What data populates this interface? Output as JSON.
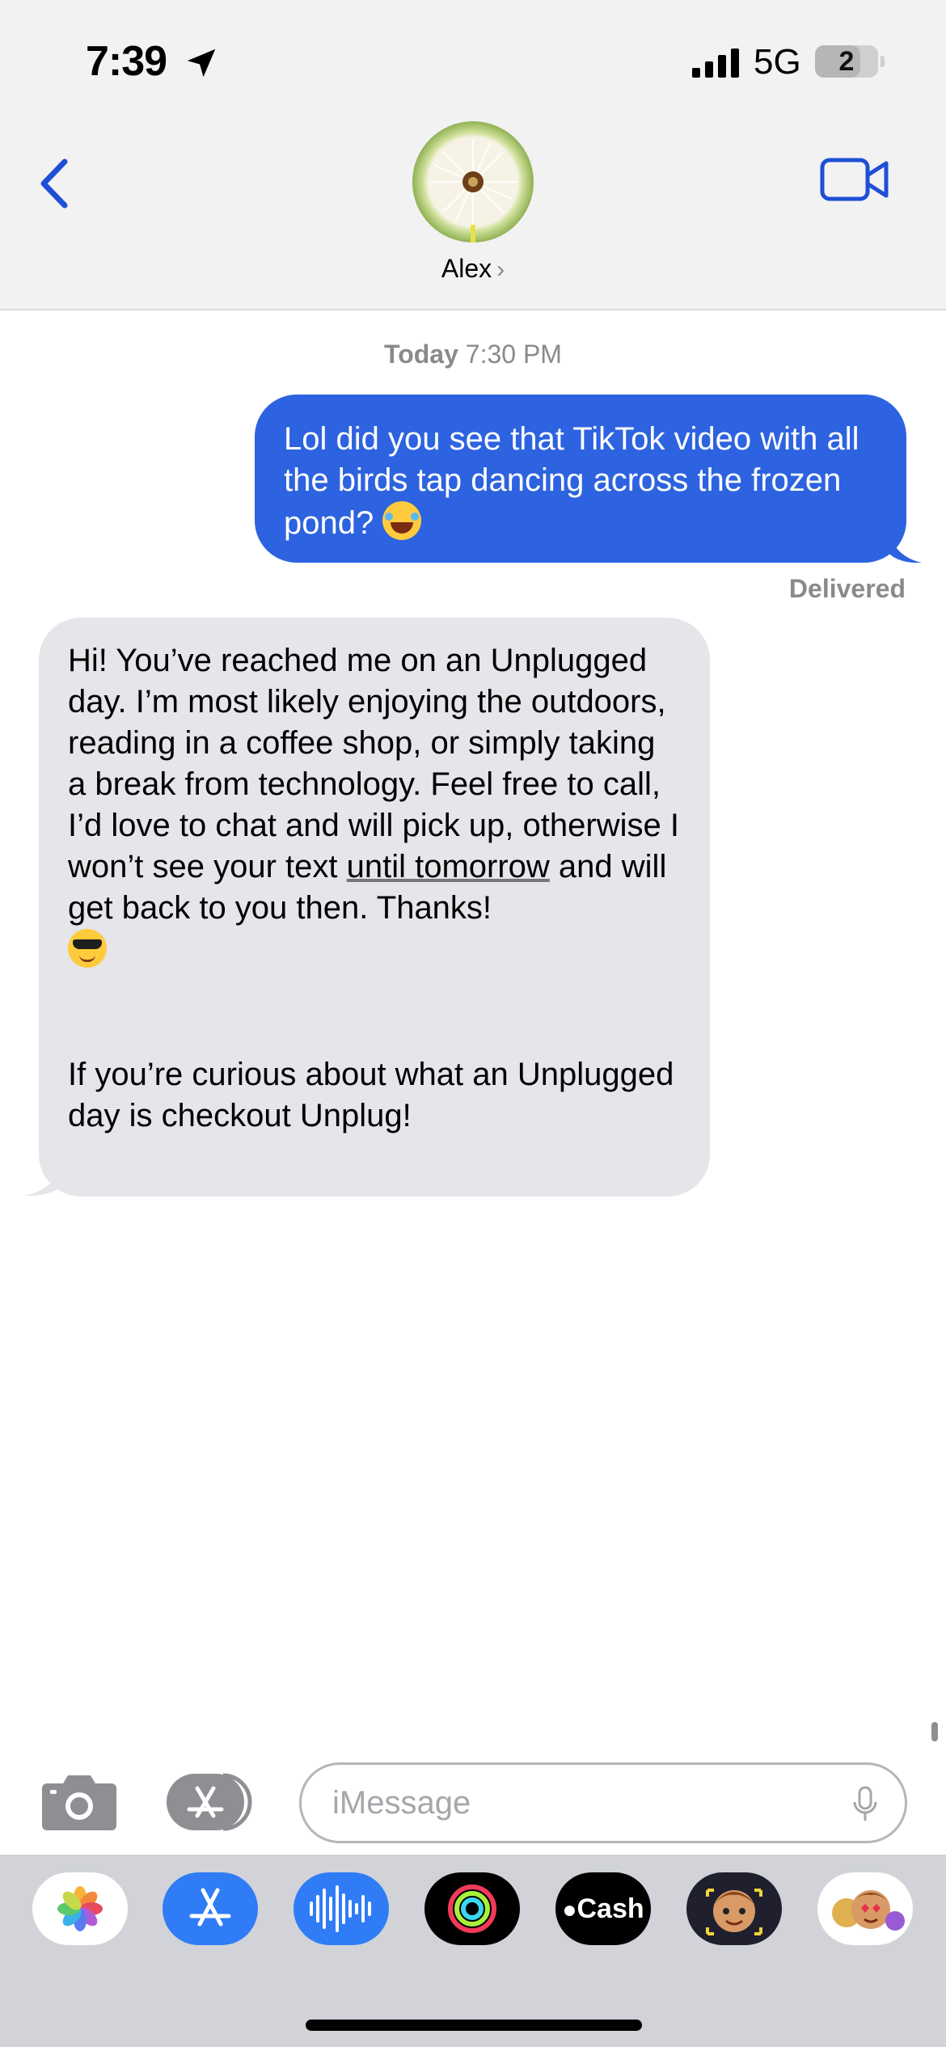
{
  "status_bar": {
    "time": "7:39",
    "network": "5G",
    "battery_level": "2",
    "location_icon": "location-arrow-icon",
    "signal_icon": "cellular-signal-icon"
  },
  "header": {
    "back_icon": "chevron-left-icon",
    "contact_name": "Alex",
    "contact_chevron": "›",
    "video_icon": "video-camera-icon",
    "avatar": "dandelion-photo"
  },
  "conversation": {
    "timestamp_day": "Today",
    "timestamp_time": "7:30 PM",
    "outgoing": {
      "text": "Lol did you see that TikTok video with all the birds tap dancing across the frozen pond?",
      "emoji": "laughing-crying-emoji",
      "status": "Delivered"
    },
    "incoming": {
      "text_before_link": "Hi! You’ve reached me on an Unplugged day. I’m most likely enjoying the outdoors, reading in a coffee shop, or simply taking a break from technology. Feel free to call, I’d love to chat and will pick up, otherwise I won’t see your text ",
      "link_text": "until tomorrow",
      "text_after_link": " and will get back to you then. Thanks!",
      "emoji": "sunglasses-emoji",
      "second_paragraph": "If you’re curious about what an Unplugged day is checkout Unplug!"
    }
  },
  "input_bar": {
    "placeholder": "iMessage",
    "camera_icon": "camera-icon",
    "apps_icon": "app-store-icon",
    "mic_icon": "microphone-icon"
  },
  "app_drawer": {
    "apps": [
      {
        "name": "photos-app-icon"
      },
      {
        "name": "app-store-app-icon"
      },
      {
        "name": "audio-message-app-icon"
      },
      {
        "name": "activity-app-icon"
      },
      {
        "name": "apple-cash-app-icon",
        "label": "Cash"
      },
      {
        "name": "memoji-app-icon"
      },
      {
        "name": "memoji-stickers-app-icon"
      }
    ]
  },
  "colors": {
    "imessage_blue": "#2d63e0",
    "incoming_bubble": "#e5e5ea",
    "header_bg": "#f2f2f2",
    "accent_blue": "#1e4fd6"
  }
}
